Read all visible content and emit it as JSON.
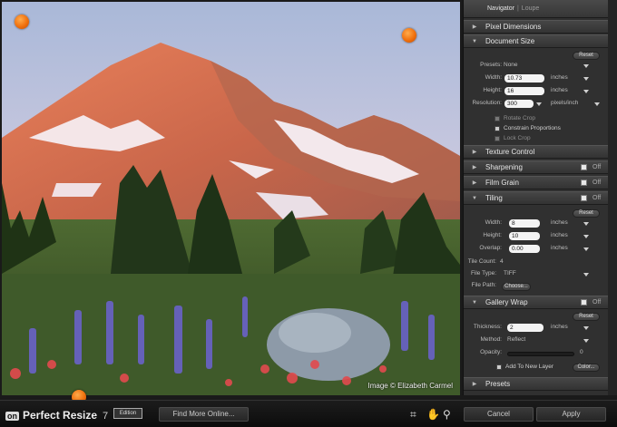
{
  "navigator": {
    "tab_active": "Navigator",
    "tab_inactive": "Loupe"
  },
  "image": {
    "credit": "Image © Elizabeth Carmel"
  },
  "sections": {
    "pixel_dimensions": "Pixel Dimensions",
    "document_size": "Document Size",
    "texture_control": "Texture Control",
    "sharpening": "Sharpening",
    "film_grain": "Film Grain",
    "tiling": "Tiling",
    "gallery_wrap": "Gallery Wrap",
    "presets": "Presets",
    "off_label": "Off"
  },
  "document_size": {
    "reset": "Reset",
    "presets_label": "Presets:",
    "presets_value": "None",
    "width_label": "Width:",
    "width_value": "10.73",
    "width_unit": "inches",
    "height_label": "Height:",
    "height_value": "16",
    "height_unit": "inches",
    "resolution_label": "Resolution:",
    "resolution_value": "300",
    "resolution_unit": "pixels/inch",
    "rotate_crop": "Rotate Crop",
    "constrain_proportions": "Constrain Proportions",
    "lock_crop": "Lock Crop"
  },
  "tiling": {
    "reset": "Reset",
    "width_label": "Width:",
    "width_value": "8",
    "width_unit": "inches",
    "height_label": "Height:",
    "height_value": "10",
    "height_unit": "inches",
    "overlap_label": "Overlap:",
    "overlap_value": "0.00",
    "overlap_unit": "inches",
    "tile_count_label": "Tile Count:",
    "tile_count_value": "4",
    "file_type_label": "File Type:",
    "file_type_value": "TIFF",
    "file_path_label": "File Path:",
    "choose": "Choose..."
  },
  "gallery_wrap": {
    "reset": "Reset",
    "thickness_label": "Thickness:",
    "thickness_value": "2",
    "thickness_unit": "inches",
    "method_label": "Method:",
    "method_value": "Reflect",
    "opacity_label": "Opacity:",
    "opacity_value": "0",
    "add_to_new_layer": "Add To New Layer",
    "color": "Color..."
  },
  "bottom": {
    "logo_prefix": "on",
    "app_name": "Perfect Resize",
    "version": "7",
    "edition": "Edition",
    "find_more": "Find More Online...",
    "cancel": "Cancel",
    "apply": "Apply"
  },
  "colors": {
    "accent_marker": "#f0700d",
    "panel_bg": "#303030",
    "header_bg": "#3e3e3e"
  }
}
